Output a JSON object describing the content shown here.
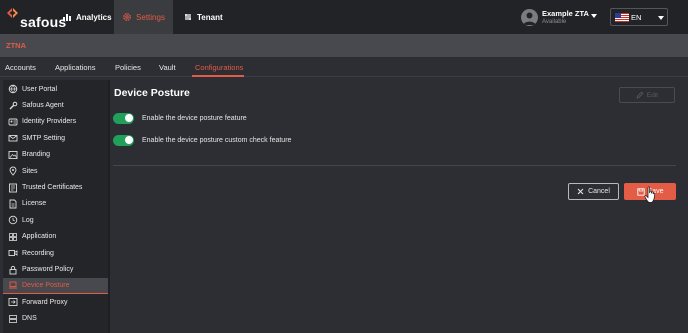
{
  "brand": {
    "name": "safous",
    "accent": "#e25b45",
    "toggle_on": "#20a05a"
  },
  "topnav": {
    "items": [
      {
        "label": "Analytics",
        "icon": "bar-chart-icon"
      },
      {
        "label": "Settings",
        "icon": "gear-icon"
      },
      {
        "label": "Tenant",
        "icon": "tenant-icon"
      }
    ],
    "active": "Settings"
  },
  "user": {
    "name": "Example ZTA",
    "status": "Available"
  },
  "language": {
    "selected": "EN",
    "flag": "us-flag-icon"
  },
  "module": {
    "title": "ZTNA"
  },
  "tabs": [
    {
      "label": "Accounts"
    },
    {
      "label": "Applications"
    },
    {
      "label": "Policies"
    },
    {
      "label": "Vault"
    },
    {
      "label": "Configurations"
    }
  ],
  "active_tab": "Configurations",
  "sidebar": {
    "items": [
      {
        "label": "User Portal",
        "icon": "globe-icon"
      },
      {
        "label": "Safous Agent",
        "icon": "wrench-icon"
      },
      {
        "label": "Identity Providers",
        "icon": "id-card-icon"
      },
      {
        "label": "SMTP Setting",
        "icon": "mail-icon"
      },
      {
        "label": "Branding",
        "icon": "image-icon"
      },
      {
        "label": "Sites",
        "icon": "location-icon"
      },
      {
        "label": "Trusted Certificates",
        "icon": "certificate-icon"
      },
      {
        "label": "License",
        "icon": "license-icon"
      },
      {
        "label": "Log",
        "icon": "clock-icon"
      },
      {
        "label": "Application",
        "icon": "app-grid-icon"
      },
      {
        "label": "Recording",
        "icon": "record-icon"
      },
      {
        "label": "Password Policy",
        "icon": "lock-icon"
      },
      {
        "label": "Device Posture",
        "icon": "laptop-icon"
      },
      {
        "label": "Forward Proxy",
        "icon": "arrow-right-icon"
      },
      {
        "label": "DNS",
        "icon": "server-icon"
      }
    ],
    "active": "Device Posture"
  },
  "main": {
    "title": "Device Posture",
    "edit_label": "Edit",
    "toggles": [
      {
        "label": "Enable the device posture feature",
        "enabled": true
      },
      {
        "label": "Enable the device posture custom check feature",
        "enabled": true
      }
    ],
    "cancel_label": "Cancel",
    "save_label": "Save"
  }
}
